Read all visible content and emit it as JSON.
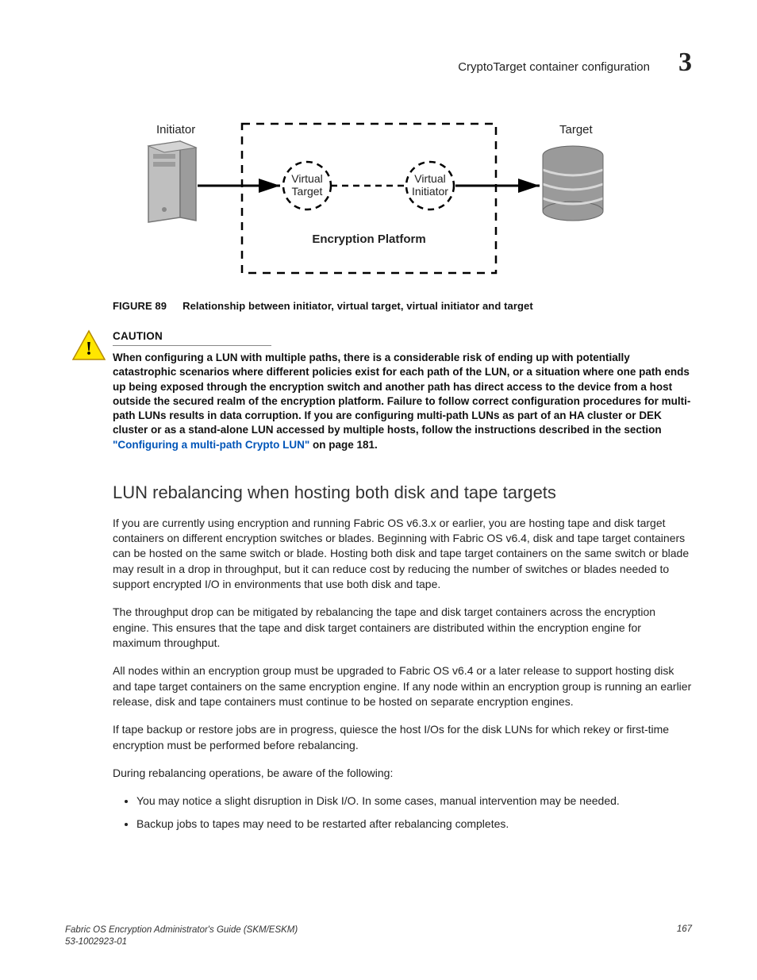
{
  "header": {
    "title": "CryptoTarget container configuration",
    "chapter": "3"
  },
  "figure": {
    "labels": {
      "initiator": "Initiator",
      "target": "Target",
      "virtual_target": "Virtual\nTarget",
      "virtual_initiator": "Virtual\nInitiator",
      "platform": "Encryption Platform"
    },
    "caption_label": "FIGURE 89",
    "caption_text": "Relationship between initiator, virtual target, virtual initiator and target"
  },
  "caution": {
    "label": "CAUTION",
    "text_pre": "When configuring a LUN with multiple paths, there is a considerable risk of ending up with potentially catastrophic scenarios where different policies exist for each path of the LUN, or a situation where one path ends up being exposed through the encryption switch and another path has direct access to the device from a host outside the secured realm of the encryption platform. Failure to follow correct configuration procedures for multi-path LUNs results in data corruption. If you are configuring multi-path LUNs as part of an HA cluster or DEK cluster or as a stand-alone LUN accessed by multiple hosts, follow the instructions described in the section ",
    "link_text": "\"Configuring a multi-path Crypto LUN\"",
    "text_post": " on page 181."
  },
  "section": {
    "heading": "LUN rebalancing when hosting both disk and tape targets",
    "p1": "If you are currently using encryption and running Fabric OS v6.3.x or earlier, you are hosting tape and disk target containers on different encryption switches or blades. Beginning with Fabric OS v6.4, disk and tape target containers can be hosted on the same switch or blade. Hosting both disk and tape target containers on the same switch or blade may result in a drop in throughput, but it can reduce cost by reducing the number of switches or blades needed to support encrypted I/O in environments that use both disk and tape.",
    "p2": "The throughput drop can be mitigated by rebalancing the tape and disk target containers across the encryption engine. This ensures that the tape and disk target containers are distributed within the encryption engine for maximum throughput.",
    "p3": "All nodes within an encryption group must be upgraded to Fabric OS v6.4 or a later release to support hosting disk and tape target containers on the same encryption engine. If any node within an encryption group is running an earlier release, disk and tape containers must continue to be hosted on separate encryption engines.",
    "p4": "If tape backup or restore jobs are in progress, quiesce the host I/Os for the disk LUNs for which rekey or first-time encryption must be performed before rebalancing.",
    "p5": "During rebalancing operations, be aware of the following:",
    "bullets": [
      "You may notice a slight disruption in Disk I/O. In some cases, manual intervention may be needed.",
      "Backup jobs to tapes may need to be restarted after rebalancing completes."
    ]
  },
  "footer": {
    "book_title": "Fabric OS Encryption Administrator's Guide (SKM/ESKM)",
    "doc_id": "53-1002923-01",
    "page": "167"
  }
}
